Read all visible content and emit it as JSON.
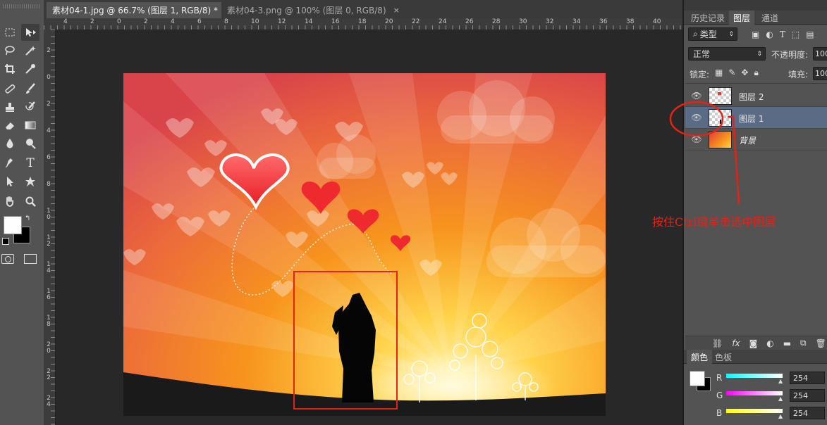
{
  "tabs": [
    {
      "label": "素材04-1.jpg @ 66.7% (图层 1, RGB/8) *",
      "close": "×",
      "active": true
    },
    {
      "label": "素材04-3.png @ 100% (图层 0, RGB/8)",
      "close": "×",
      "active": false
    }
  ],
  "ruler_top_labels": [
    "4",
    "2",
    "0",
    "2",
    "4",
    "6",
    "8",
    "10",
    "12",
    "14",
    "16",
    "18",
    "20",
    "22",
    "24",
    "26",
    "28",
    "30",
    "32",
    "34",
    "36",
    "38",
    "40"
  ],
  "ruler_left_labels": [
    "2",
    "0",
    "2",
    "4",
    "6",
    "8",
    "1\n0",
    "1\n2",
    "1\n4",
    "1\n6",
    "1\n8",
    "2\n0",
    "2\n2",
    "2\n4"
  ],
  "panels": {
    "top_tabs": [
      "历史记录",
      "图层",
      "通道"
    ],
    "filter_kind": "类型",
    "blend_mode": "正常",
    "opacity_label": "不透明度:",
    "opacity_value": "100",
    "lock_label": "锁定:",
    "fill_label": "填充:",
    "fill_value": "100",
    "layers": [
      {
        "name": "图层 2",
        "selected": false
      },
      {
        "name": "图层 1",
        "selected": true
      },
      {
        "name": "背景",
        "selected": false
      }
    ],
    "color_tabs": [
      "颜色",
      "色板"
    ],
    "channels": [
      {
        "label": "R",
        "value": "254"
      },
      {
        "label": "G",
        "value": "254"
      },
      {
        "label": "B",
        "value": "254"
      }
    ]
  },
  "annotation": {
    "text": "按住Ctrl键单击选中图层",
    "color": "#e2231a"
  },
  "colors": {
    "annotation": "#e2231a",
    "selected_layer": "#5a6c85",
    "panel_bg": "#535353",
    "workspace_bg": "#282828"
  }
}
